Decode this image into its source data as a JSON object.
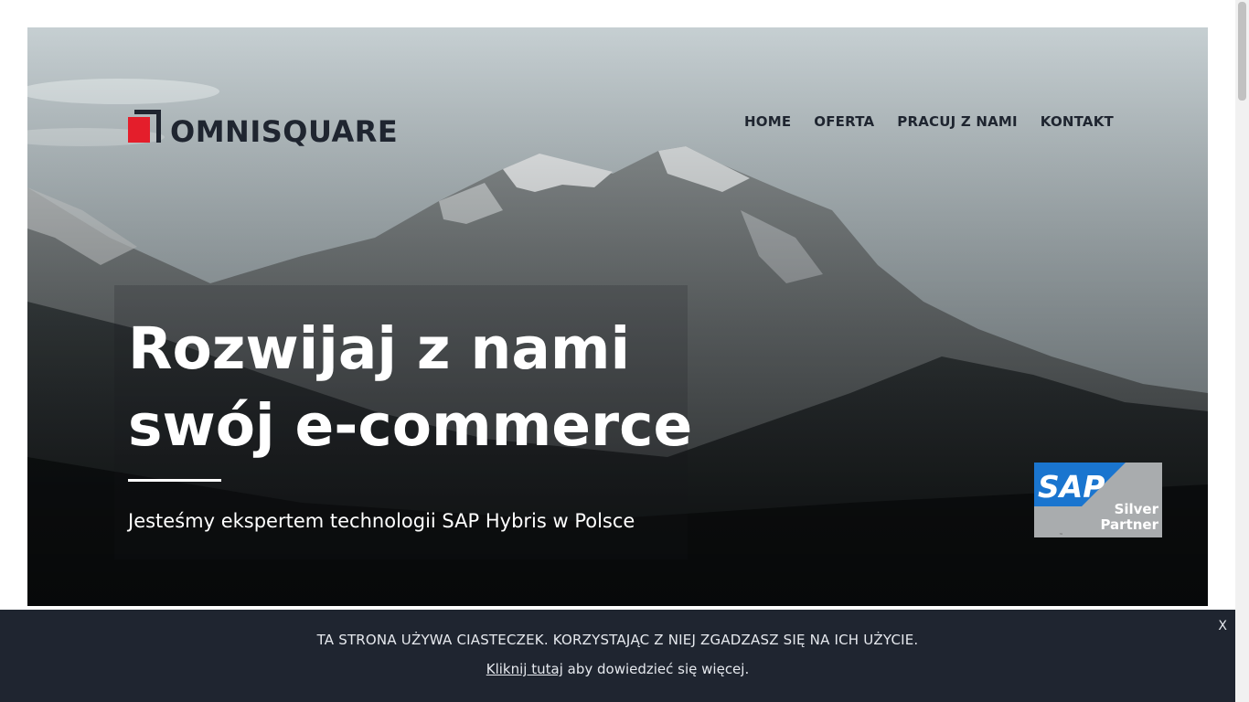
{
  "brand": {
    "name": "OMNISQUARE",
    "accent_red": "#e41e2b",
    "dark_navy": "#1f2530"
  },
  "nav": {
    "items": [
      {
        "label": "HOME"
      },
      {
        "label": "OFERTA"
      },
      {
        "label": "PRACUJ Z NAMI"
      },
      {
        "label": "KONTAKT"
      }
    ]
  },
  "hero": {
    "headline_line1": "Rozwijaj z nami",
    "headline_line2": "swój e-commerce",
    "subheadline": "Jesteśmy ekspertem technologii SAP Hybris w Polsce",
    "background_icon": "mountain-landscape-image"
  },
  "partner_badge": {
    "brand": "SAP",
    "line1": "Silver",
    "line2": "Partner",
    "trademark": "™",
    "blue": "#1a75cf",
    "silver": "#a9acae"
  },
  "cookie_bar": {
    "message": "TA STRONA UŻYWA CIASTECZEK. KORZYSTAJĄC Z NIEJ ZGADZASZ SIĘ NA ICH UŻYCIE.",
    "link_label": "Kliknij tutaj",
    "after_link": " aby dowiedzieć się więcej.",
    "close_label": "X"
  }
}
